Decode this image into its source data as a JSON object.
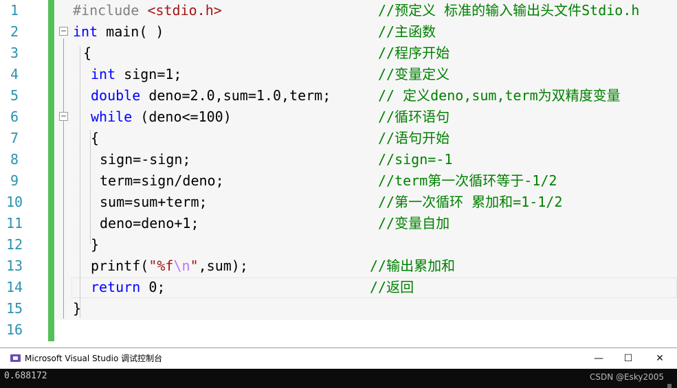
{
  "editor": {
    "line_numbers": [
      "1",
      "2",
      "3",
      "4",
      "5",
      "6",
      "7",
      "8",
      "9",
      "10",
      "11",
      "12",
      "13",
      "14",
      "15",
      "16"
    ],
    "colors": {
      "line_number": "#2b91af",
      "keyword": "#0000ff",
      "comment": "#008000",
      "string": "#a31515",
      "escape": "#b776fb",
      "preprocessor": "#808080",
      "text": "#000000",
      "change_bar": "#57bf57"
    },
    "lines": [
      {
        "segs": [
          {
            "t": "#include ",
            "c": "preprocessor"
          },
          {
            "t": "<stdio.h>",
            "c": "string"
          }
        ],
        "comment": "//预定义 标准的输入输出头文件Stdio.h"
      },
      {
        "segs": [
          {
            "t": "int",
            "c": "keyword"
          },
          {
            "t": " main( )",
            "c": "text"
          }
        ],
        "comment": "//主函数"
      },
      {
        "segs": [
          {
            "t": "{",
            "c": "text"
          }
        ],
        "comment": "//程序开始"
      },
      {
        "segs": [
          {
            "t": "int",
            "c": "keyword"
          },
          {
            "t": " sign=1;",
            "c": "text"
          }
        ],
        "comment": "//变量定义"
      },
      {
        "segs": [
          {
            "t": "double",
            "c": "keyword"
          },
          {
            "t": " deno=2.0,sum=1.0,term;",
            "c": "text"
          }
        ],
        "comment": "// 定义deno,sum,term为双精度变量"
      },
      {
        "segs": [
          {
            "t": "while",
            "c": "keyword"
          },
          {
            "t": " (deno<=100)",
            "c": "text"
          }
        ],
        "comment": "//循环语句"
      },
      {
        "segs": [
          {
            "t": "{",
            "c": "text"
          }
        ],
        "comment": "//语句开始"
      },
      {
        "segs": [
          {
            "t": "sign=-sign;",
            "c": "text"
          }
        ],
        "comment": "//sign=-1"
      },
      {
        "segs": [
          {
            "t": "term=sign/deno;",
            "c": "text"
          }
        ],
        "comment": "//term第一次循环等于-1/2"
      },
      {
        "segs": [
          {
            "t": "sum=sum+term;",
            "c": "text"
          }
        ],
        "comment": "//第一次循环 累加和=1-1/2"
      },
      {
        "segs": [
          {
            "t": "deno=deno+1;",
            "c": "text"
          }
        ],
        "comment": "//变量自加"
      },
      {
        "segs": [
          {
            "t": "}",
            "c": "text"
          }
        ],
        "comment": ""
      },
      {
        "segs": [
          {
            "t": "printf(",
            "c": "text"
          },
          {
            "t": "\"%f",
            "c": "string"
          },
          {
            "t": "\\n",
            "c": "escape"
          },
          {
            "t": "\"",
            "c": "string"
          },
          {
            "t": ",sum);",
            "c": "text"
          }
        ],
        "comment": "//输出累加和"
      },
      {
        "segs": [
          {
            "t": "return",
            "c": "keyword"
          },
          {
            "t": " 0;",
            "c": "text"
          }
        ],
        "comment": "//返回"
      },
      {
        "segs": [
          {
            "t": "}",
            "c": "text"
          }
        ],
        "comment": ""
      },
      {
        "segs": [],
        "comment": ""
      }
    ]
  },
  "console": {
    "title": "Microsoft Visual Studio 调试控制台",
    "output": "0.688172",
    "watermark": "CSDN @Esky2005",
    "minimize_glyph": "—",
    "maximize_glyph": "☐",
    "close_glyph": "✕",
    "icon": "visual-studio-icon"
  }
}
